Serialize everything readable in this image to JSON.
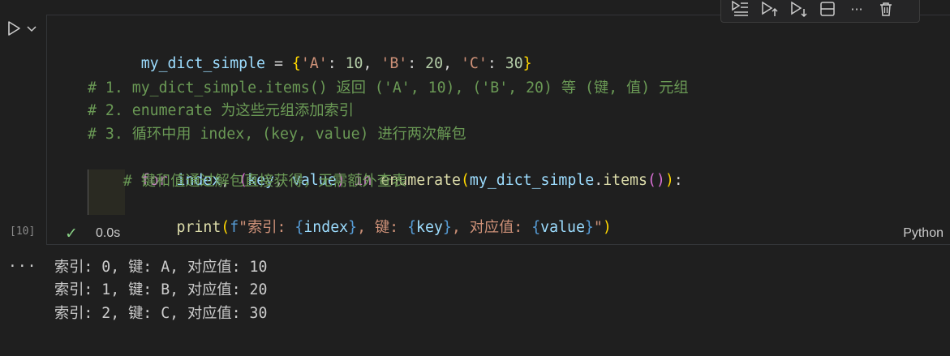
{
  "cell": {
    "execution_count": "[10]",
    "exec_time": "0.0s",
    "language": "Python",
    "code_lines": [
      "my_dict_simple = {'A': 10, 'B': 20, 'C': 30}",
      "",
      "# 1. my_dict_simple.items() 返回 ('A', 10), ('B', 20) 等 (键, 值) 元组",
      "# 2. enumerate 为这些元组添加索引",
      "# 3. 循环中用 index, (key, value) 进行两次解包",
      "for index, (key, value) in enumerate(my_dict_simple.items()):",
      "    # 键和值通过解包直接获得，无需额外查表",
      "    print(f\"索引: {index}, 键: {key}, 对应值: {value}\")"
    ]
  },
  "toolbar": {
    "icons": [
      "run-by-line-icon",
      "execute-above-icon",
      "execute-below-icon",
      "split-cell-icon",
      "more-icon",
      "delete-icon"
    ],
    "more_label": "···"
  },
  "output": {
    "more_label": "···",
    "lines": [
      "索引: 0, 键: A, 对应值: 10",
      "索引: 1, 键: B, 对应值: 20",
      "索引: 2, 键: C, 对应值: 30"
    ]
  },
  "colors": {
    "background": "#1f1f1f",
    "variable": "#9cdcfe",
    "string": "#ce9178",
    "number": "#b5cea8",
    "comment": "#6a9955",
    "keyword": "#c586c0",
    "function": "#dcdcaa",
    "success": "#89d185"
  }
}
